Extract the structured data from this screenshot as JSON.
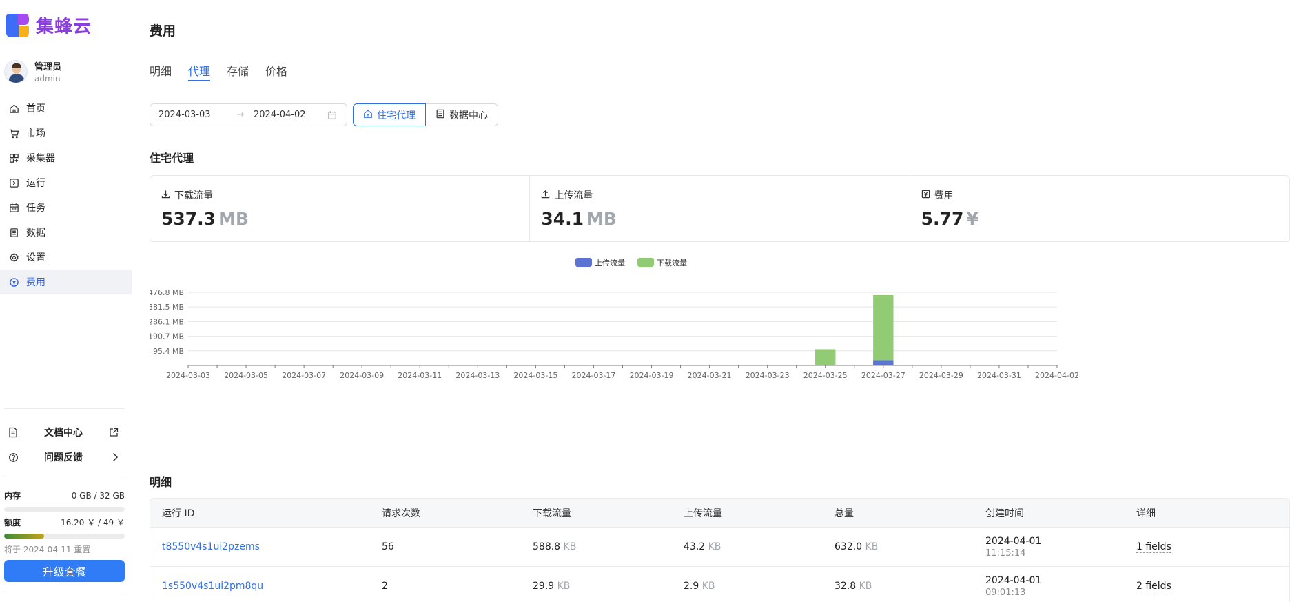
{
  "sidebar": {
    "brand": "集蜂云",
    "user": {
      "name": "管理员",
      "role": "admin"
    },
    "nav": [
      {
        "label": "首页",
        "icon": "home-icon"
      },
      {
        "label": "市场",
        "icon": "cart-icon"
      },
      {
        "label": "采集器",
        "icon": "collector-icon"
      },
      {
        "label": "运行",
        "icon": "run-icon"
      },
      {
        "label": "任务",
        "icon": "calendar-icon"
      },
      {
        "label": "数据",
        "icon": "data-icon"
      },
      {
        "label": "设置",
        "icon": "gear-icon"
      },
      {
        "label": "费用",
        "icon": "coin-icon",
        "active": true
      }
    ],
    "docs_label": "文档中心",
    "feedback_label": "问题反馈",
    "memory": {
      "label": "内存",
      "value": "0 GB / 32 GB",
      "fraction": 0
    },
    "credit": {
      "label": "额度",
      "value": "16.20 ￥ / 49 ￥",
      "fraction": 0.33
    },
    "reset_note": "将于 2024-04-11 重置",
    "upgrade_label": "升级套餐"
  },
  "page": {
    "title": "费用",
    "tabs": [
      "明细",
      "代理",
      "存储",
      "价格"
    ],
    "active_tab": "代理",
    "date_start": "2024-03-03",
    "date_arrow": "→",
    "date_end": "2024-04-02",
    "segments": [
      {
        "label": "住宅代理",
        "icon": "home-icon",
        "active": true
      },
      {
        "label": "数据中心",
        "icon": "server-icon",
        "active": false
      }
    ],
    "section_proxy": "住宅代理",
    "section_detail": "明细"
  },
  "stats": [
    {
      "label": "下载流量",
      "icon": "download-icon",
      "value": "537.3",
      "unit": "MB"
    },
    {
      "label": "上传流量",
      "icon": "upload-icon",
      "value": "34.1",
      "unit": "MB"
    },
    {
      "label": "费用",
      "icon": "fee-icon",
      "value": "5.77",
      "unit": "¥"
    }
  ],
  "chart_data": {
    "type": "bar",
    "stacked": true,
    "x": [
      "2024-03-03",
      "2024-03-04",
      "2024-03-05",
      "2024-03-06",
      "2024-03-07",
      "2024-03-08",
      "2024-03-09",
      "2024-03-10",
      "2024-03-11",
      "2024-03-12",
      "2024-03-13",
      "2024-03-14",
      "2024-03-15",
      "2024-03-16",
      "2024-03-17",
      "2024-03-18",
      "2024-03-19",
      "2024-03-20",
      "2024-03-21",
      "2024-03-22",
      "2024-03-23",
      "2024-03-24",
      "2024-03-25",
      "2024-03-26",
      "2024-03-27",
      "2024-03-28",
      "2024-03-29",
      "2024-03-30",
      "2024-03-31",
      "2024-04-01",
      "2024-04-02"
    ],
    "x_tick_labels": [
      "2024-03-03",
      "2024-03-05",
      "2024-03-07",
      "2024-03-09",
      "2024-03-11",
      "2024-03-13",
      "2024-03-15",
      "2024-03-17",
      "2024-03-19",
      "2024-03-21",
      "2024-03-23",
      "2024-03-25",
      "2024-03-27",
      "2024-03-29",
      "2024-03-31",
      "2024-04-02"
    ],
    "y_ticks": [
      95.4,
      190.7,
      286.1,
      381.5,
      476.8
    ],
    "y_tick_labels": [
      "95.4 MB",
      "190.7 MB",
      "286.1 MB",
      "381.5 MB",
      "476.8 MB"
    ],
    "ylim": [
      0,
      476.8
    ],
    "legend_position": "top-center",
    "grid": true,
    "series": [
      {
        "name": "上传流量",
        "color": "#5b73d1",
        "values": [
          0,
          0,
          0,
          0,
          0,
          0,
          0,
          0,
          0,
          0,
          0,
          0,
          0,
          0,
          0,
          0,
          0,
          0,
          0,
          0,
          0,
          0,
          0,
          0,
          34,
          0,
          0,
          0,
          0,
          0,
          0
        ]
      },
      {
        "name": "下载流量",
        "color": "#91cc75",
        "values": [
          0,
          0,
          0,
          0,
          0,
          0,
          0,
          0,
          0,
          0,
          0,
          0,
          0,
          0,
          0,
          0,
          0,
          0,
          0,
          0,
          0,
          0,
          106,
          0,
          425,
          0,
          0,
          0,
          0,
          0,
          0
        ]
      }
    ]
  },
  "table": {
    "headers": [
      "运行 ID",
      "请求次数",
      "下载流量",
      "上传流量",
      "总量",
      "创建时间",
      "详细"
    ],
    "rows": [
      {
        "id": "t8550v4s1ui2pzems",
        "requests": "56",
        "down": "588.8",
        "down_unit": "KB",
        "up": "43.2",
        "up_unit": "KB",
        "total": "632.0",
        "total_unit": "KB",
        "date": "2024-04-01",
        "time": "11:15:14",
        "details": "1 fields"
      },
      {
        "id": "1s550v4s1ui2pm8qu",
        "requests": "2",
        "down": "29.9",
        "down_unit": "KB",
        "up": "2.9",
        "up_unit": "KB",
        "total": "32.8",
        "total_unit": "KB",
        "date": "2024-04-01",
        "time": "09:01:13",
        "details": "2 fields"
      }
    ]
  }
}
